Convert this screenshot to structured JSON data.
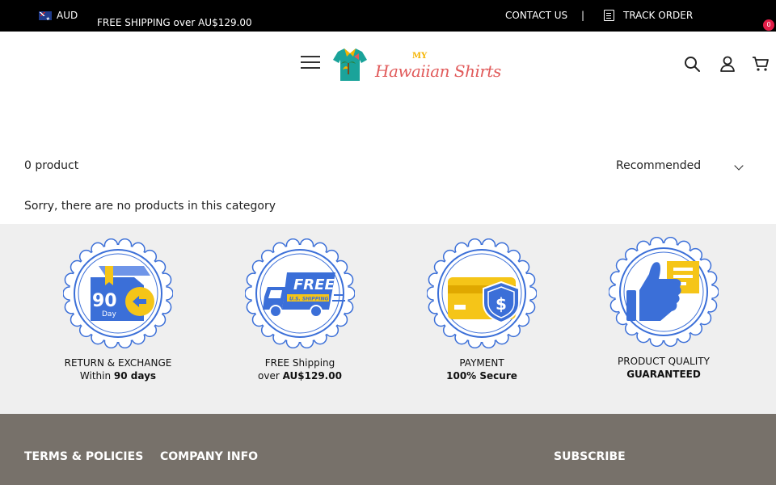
{
  "topbar": {
    "currency": "AUD",
    "shipping_promo": "FREE SHIPPING over AU$129.00",
    "contact_us": "CONTACT US",
    "divider": "|",
    "track_order": "TRACK ORDER"
  },
  "header": {
    "logo_my": "MY",
    "logo_main": "Hawaiian Shirts",
    "cart_count": "0"
  },
  "catalog": {
    "product_count": "0 product",
    "sort_selected": "Recommended",
    "empty_message": "Sorry, there are no products in this category"
  },
  "features": [
    {
      "icon": "return-box-icon",
      "badge_number": "90",
      "badge_unit": "Day",
      "line1": "RETURN & EXCHANGE",
      "line2_prefix": "Within ",
      "line2_bold": "90 days"
    },
    {
      "icon": "free-shipping-truck-icon",
      "badge_free": "FREE",
      "badge_sub": "U.S. SHIPPING",
      "line1": "FREE Shipping",
      "line2_prefix": "over ",
      "line2_bold": "AU$129.00"
    },
    {
      "icon": "secure-payment-icon",
      "line1": "PAYMENT",
      "line2_prefix": "",
      "line2_bold": "100% Secure"
    },
    {
      "icon": "thumbs-up-icon",
      "line1": "PRODUCT QUALITY",
      "line2_prefix": "",
      "line2_bold": "GUARANTEED"
    }
  ],
  "footer": {
    "terms": "TERMS & POLICIES",
    "company": "COMPANY INFO",
    "subscribe": "SUBSCRIBE"
  },
  "colors": {
    "topbar_bg": "#000000",
    "badge_blue": "#3b6fd8",
    "badge_yellow": "#f5c518",
    "cart_badge": "#e11d48",
    "features_bg": "#efefef",
    "footer_bg": "#77716a"
  }
}
